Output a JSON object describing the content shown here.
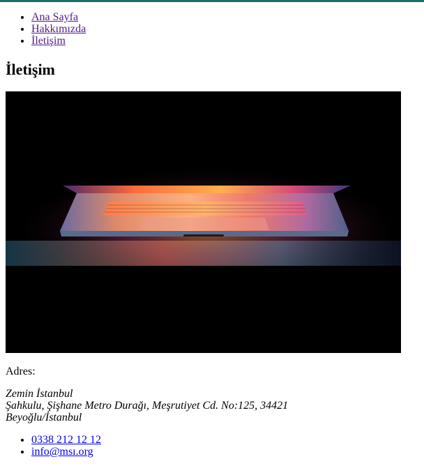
{
  "colors": {
    "top_strip": "#1b6f6a",
    "visited_link": "#551a8b",
    "link": "#0000ee"
  },
  "nav": {
    "items": [
      {
        "label": "Ana Sayfa"
      },
      {
        "label": "Hakkımızda"
      },
      {
        "label": "İletişim"
      }
    ]
  },
  "page_title": "İletişim",
  "hero": {
    "description": "Partially opened laptop glowing with colorful light on a black background"
  },
  "address": {
    "label": "Adres:",
    "lines": [
      "Zemin İstanbul",
      "Şahkulu, Şişhane Metro Durağı, Meşrutiyet Cd. No:125, 34421",
      "Beyoğlu/İstanbul"
    ]
  },
  "contact": {
    "phone": "0338 212 12 12",
    "email": "info@msı.org"
  }
}
